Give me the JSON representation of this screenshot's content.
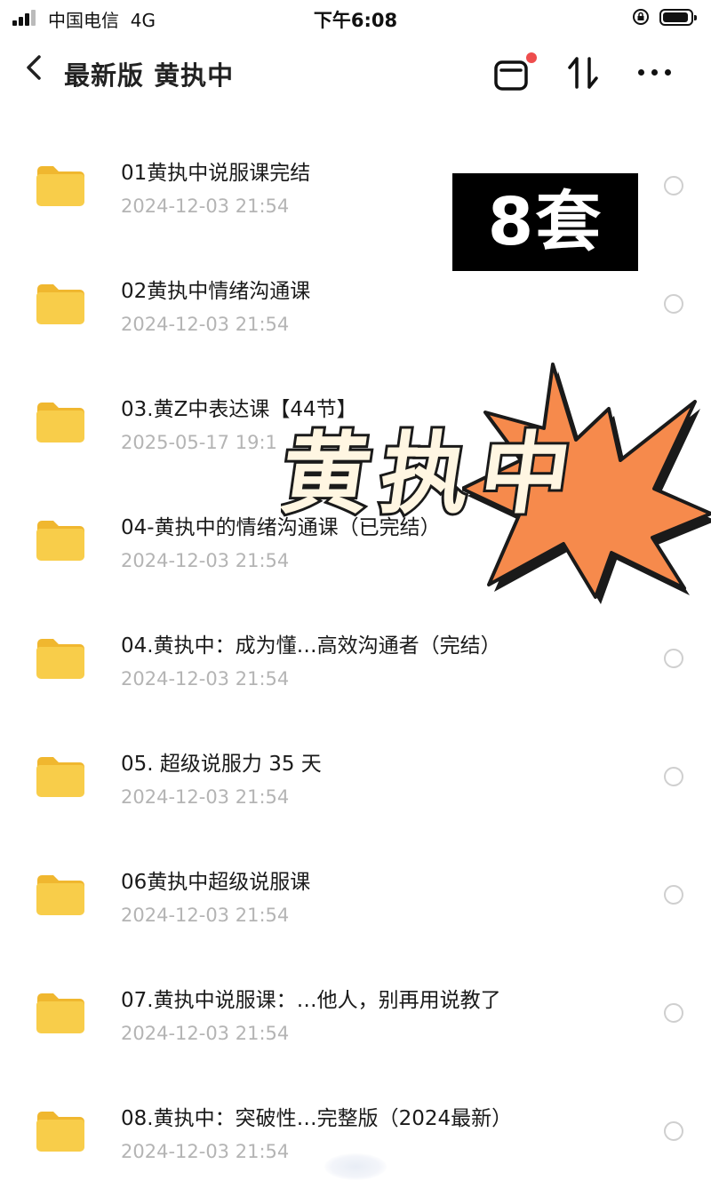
{
  "status_bar": {
    "carrier": "中国电信",
    "network": "4G",
    "time": "下午6:08"
  },
  "nav": {
    "title": "最新版 黄执中"
  },
  "files": [
    {
      "name": "01黄执中说服课完结",
      "date": "2024-12-03 21:54"
    },
    {
      "name": "02黄执中情绪沟通课",
      "date": "2024-12-03 21:54"
    },
    {
      "name": "03.黄Z中表达课【44节】",
      "date": "2025-05-17 19:1"
    },
    {
      "name": "04-黄执中的情绪沟通课（已完结）",
      "date": "2024-12-03 21:54"
    },
    {
      "name": "04.黄执中：成为懂…高效沟通者（完结）",
      "date": "2024-12-03 21:54"
    },
    {
      "name": "05. 超级说服力 35 天",
      "date": "2024-12-03 21:54"
    },
    {
      "name": "06黄执中超级说服课",
      "date": "2024-12-03 21:54"
    },
    {
      "name": "07.黄执中说服课：…他人，别再用说教了",
      "date": "2024-12-03 21:54"
    },
    {
      "name": "08.黄执中：突破性…完整版（2024最新）",
      "date": "2024-12-03 21:54"
    }
  ],
  "overlay": {
    "sets_label": "8套",
    "big_name": "黄执中"
  },
  "colors": {
    "folder": "#f7c842",
    "burst": "#f68a4c",
    "date_text": "#b4b4b4"
  },
  "icons": {
    "back": "chevron-left-icon",
    "window": "window-icon",
    "sort": "sort-icon",
    "more": "more-icon",
    "folder": "folder-icon"
  }
}
